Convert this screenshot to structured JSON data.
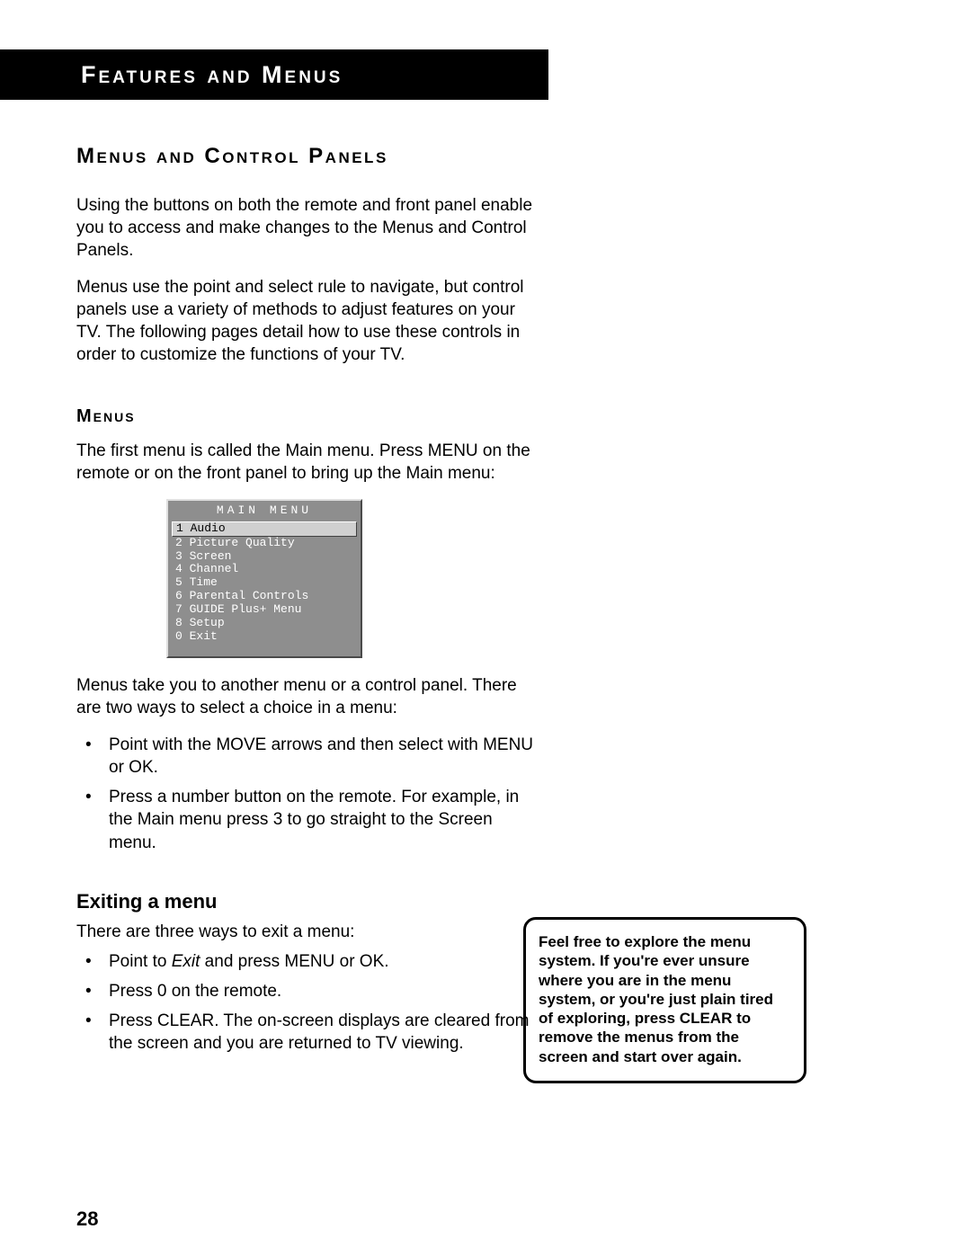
{
  "banner": "Features and Menus",
  "sections": {
    "h1": "Menus and Control Panels",
    "p1": "Using the buttons on both the remote and front panel enable you to access and make changes to the Menus and Control Panels.",
    "p2": "Menus use the point and select rule to navigate, but control panels use a variety of methods to adjust features on your TV. The following pages detail how to use these controls in order to customize the functions of your TV.",
    "h2": "Menus",
    "p3": "The first menu is called the Main menu. Press MENU on the remote or on the front panel to bring up the Main menu:",
    "p4": "Menus take you to another menu or a control panel. There are two ways to select a choice in a menu:",
    "bullets1": {
      "a": "Point with the MOVE arrows and then select with MENU or OK.",
      "b": "Press a number button on the remote. For example, in the Main menu press 3 to go straight to the Screen menu."
    },
    "h3": "Exiting a menu",
    "p5": "There are three ways to exit a menu:",
    "bullets2": {
      "a_pre": "Point to ",
      "a_em": "Exit",
      "a_post": " and press MENU or OK.",
      "b": "Press 0 on the remote.",
      "c": "Press CLEAR. The on-screen displays are cleared from the screen and you are returned to TV viewing."
    }
  },
  "main_menu": {
    "title": "MAIN MENU",
    "items": [
      {
        "num": "1",
        "label": "Audio",
        "selected": true
      },
      {
        "num": "2",
        "label": "Picture Quality",
        "selected": false
      },
      {
        "num": "3",
        "label": "Screen",
        "selected": false
      },
      {
        "num": "4",
        "label": "Channel",
        "selected": false
      },
      {
        "num": "5",
        "label": "Time",
        "selected": false
      },
      {
        "num": "6",
        "label": "Parental Controls",
        "selected": false
      },
      {
        "num": "7",
        "label": "GUIDE Plus+ Menu",
        "selected": false
      },
      {
        "num": "8",
        "label": "Setup",
        "selected": false
      },
      {
        "num": "0",
        "label": "Exit",
        "selected": false
      }
    ]
  },
  "tip": "Feel free to explore the menu system. If you're ever unsure where you are in the menu system, or you're just plain tired of exploring, press CLEAR to remove the menus from the screen and start over again.",
  "page_number": "28"
}
